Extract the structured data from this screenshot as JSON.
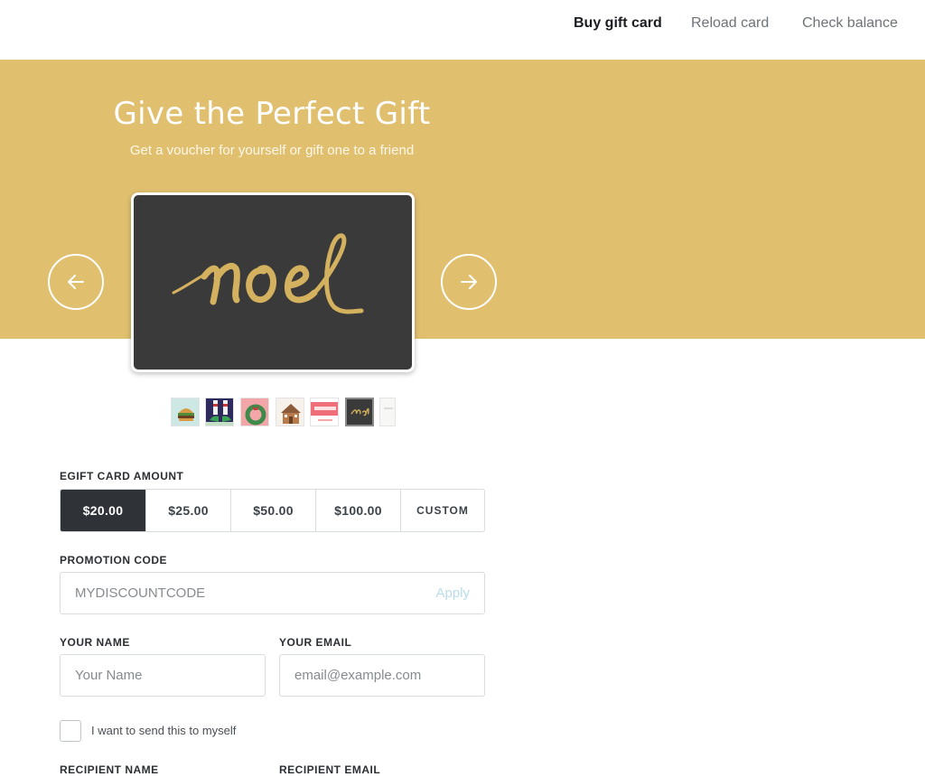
{
  "nav": {
    "buy_label": "Buy gift card",
    "reload_label": "Reload card",
    "check_label": "Check balance"
  },
  "hero": {
    "title": "Give the Perfect Gift",
    "subtitle": "Get a voucher for yourself or gift one to a friend",
    "background_color": "#e0bf6f",
    "prev_icon": "arrow-left-icon",
    "next_icon": "arrow-right-icon"
  },
  "card": {
    "design_text": "noel",
    "background_color": "#3a3a3a",
    "lettering_color": "#d4b15e"
  },
  "thumbnails": [
    {
      "name": "burger",
      "selected": false
    },
    {
      "name": "elf-feet",
      "selected": false
    },
    {
      "name": "wreath",
      "selected": false
    },
    {
      "name": "gingerbread-house",
      "selected": false
    },
    {
      "name": "happy-holidays",
      "selected": false
    },
    {
      "name": "noel",
      "selected": true
    },
    {
      "name": "blank-white",
      "selected": false
    }
  ],
  "form": {
    "amount_label": "EGIFT CARD AMOUNT",
    "amounts": [
      "$20.00",
      "$25.00",
      "$50.00",
      "$100.00",
      "CUSTOM"
    ],
    "selected_amount": "$20.00",
    "promo_label": "PROMOTION CODE",
    "promo_placeholder": "MYDISCOUNTCODE",
    "apply_label": "Apply",
    "your_name_label": "YOUR NAME",
    "your_name_placeholder": "Your Name",
    "your_email_label": "YOUR EMAIL",
    "your_email_placeholder": "email@example.com",
    "send_to_self_label": "I want to send this to myself",
    "recipient_name_label": "RECIPIENT NAME",
    "recipient_email_label": "RECIPIENT EMAIL"
  },
  "colors": {
    "accent_dark": "#2f3338",
    "apply_link": "#b9dde9"
  }
}
